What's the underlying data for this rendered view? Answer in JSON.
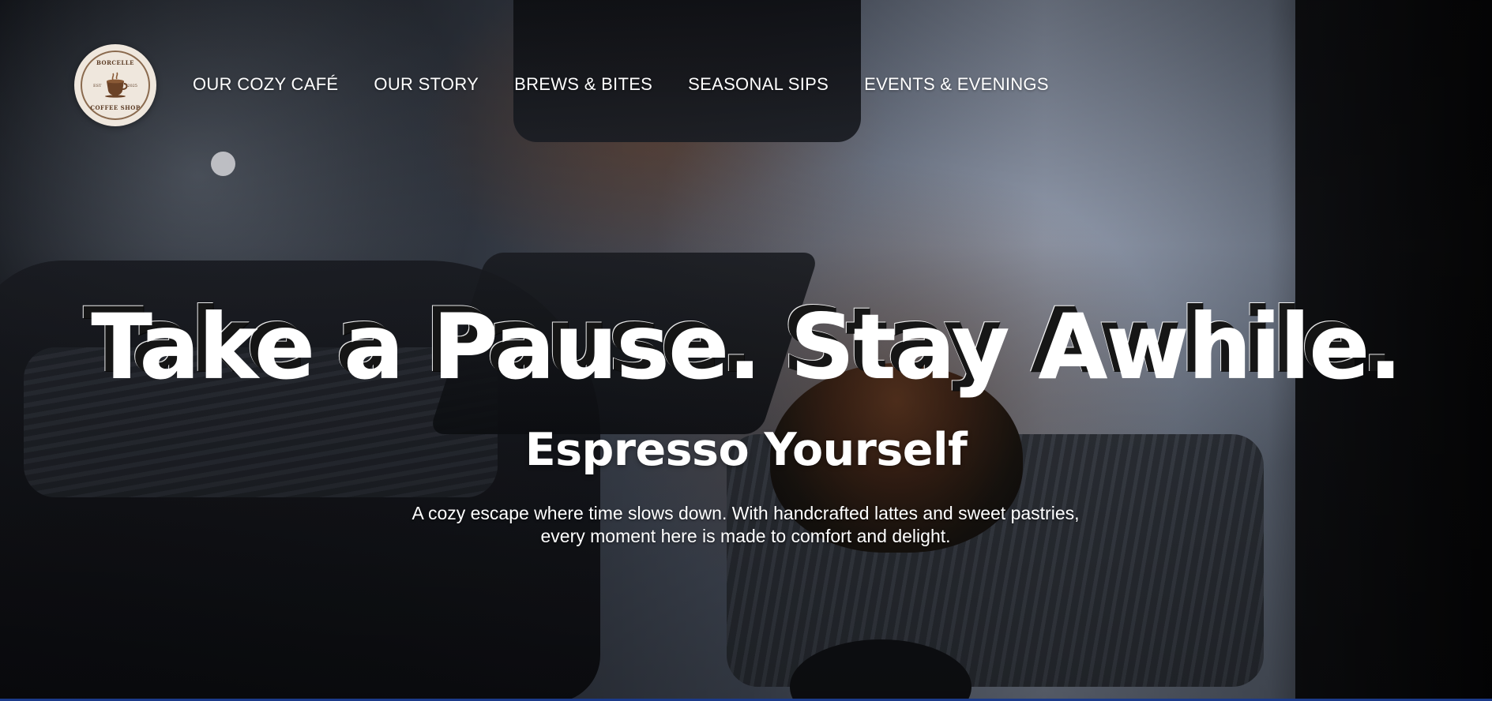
{
  "logo": {
    "top_text": "BORCELLE",
    "bottom_text": "COFFEE SHOP",
    "est_left": "EST",
    "est_right": "2025",
    "icon": "coffee-cup-icon"
  },
  "nav": {
    "items": [
      {
        "label": "OUR COZY CAFÉ"
      },
      {
        "label": "OUR STORY"
      },
      {
        "label": "BREWS & BITES"
      },
      {
        "label": "SEASONAL SIPS"
      },
      {
        "label": "EVENTS & EVENINGS"
      }
    ]
  },
  "hero": {
    "title": "Take a Pause. Stay Awhile.",
    "subtitle": "Espresso Yourself",
    "description": "A cozy escape where time slows down. With handcrafted lattes and sweet pastries, every moment here is made to comfort and delight."
  },
  "colors": {
    "text": "#ffffff",
    "logo_background": "#efe7dd",
    "logo_brown": "#5b3b24",
    "bottom_accent": "#1b3a8a"
  }
}
